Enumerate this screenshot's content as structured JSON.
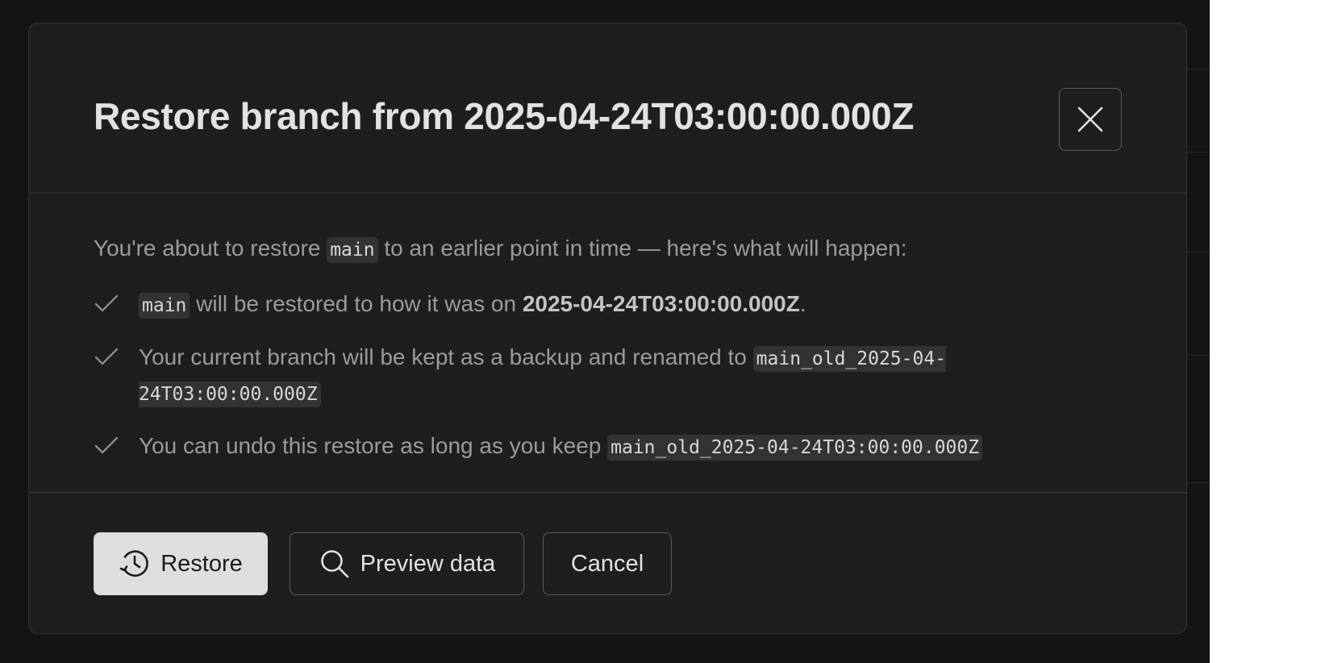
{
  "modal": {
    "title": "Restore branch from 2025-04-24T03:00:00.000Z",
    "close_icon": "close-icon"
  },
  "body": {
    "intro_before": "You're about to restore ",
    "intro_code": "main",
    "intro_after": " to an earlier point in time — here's what will happen:",
    "items": [
      {
        "code": "main",
        "text_before": " will be restored to how it was on ",
        "bold": "2025-04-24T03:00:00.000Z",
        "text_after": "."
      },
      {
        "text": "Your current branch will be kept as a backup and renamed to ",
        "code": "main_old_2025-04-24T03:00:00.000Z"
      },
      {
        "text": "You can undo this restore as long as you keep ",
        "code": "main_old_2025-04-24T03:00:00.000Z"
      }
    ],
    "check_icon": "check-icon"
  },
  "footer": {
    "restore_label": "Restore",
    "restore_icon": "history-icon",
    "preview_label": "Preview data",
    "preview_icon": "search-icon",
    "cancel_label": "Cancel"
  },
  "colors": {
    "backdrop": "#141414",
    "modal_bg": "#1e1e1e",
    "border": "#383838",
    "title_text": "#e2e2e2",
    "body_text": "#9b9b9b",
    "code_bg": "#333333",
    "primary_button_bg": "#dedede"
  }
}
